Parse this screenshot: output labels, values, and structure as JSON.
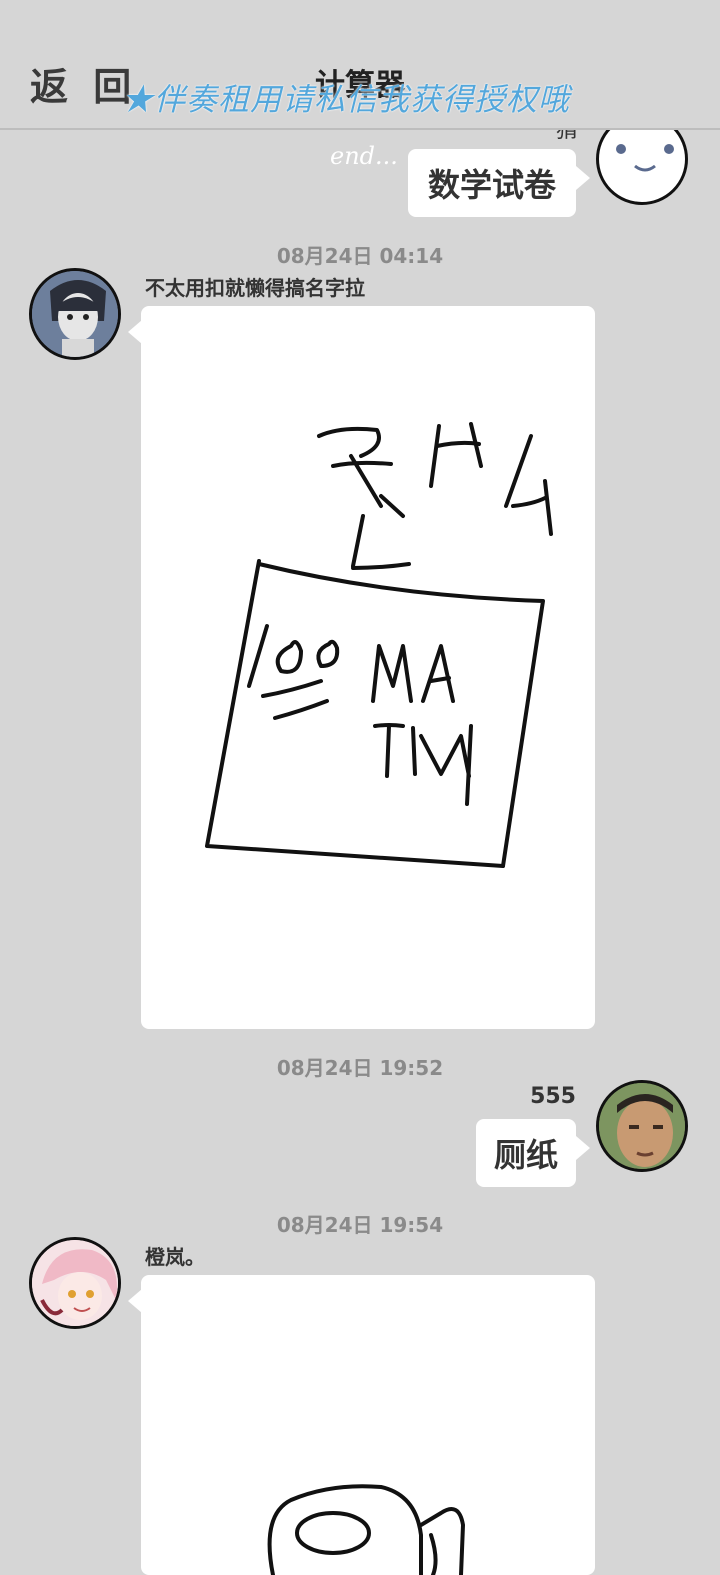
{
  "header": {
    "back_label": "返 回",
    "title": "计算器",
    "watermark": "★伴奏租用请私信我获得授权哦"
  },
  "messages": [
    {
      "id": "m1",
      "side": "right",
      "sender": "",
      "caption": "end...",
      "text": "数学试卷",
      "avatar_icon": "smiley-face-icon"
    },
    {
      "id": "m2",
      "timestamp": "08月24日  04:14",
      "side": "left",
      "sender": "不太用扣就懒得搞名字拉",
      "content_type": "drawing",
      "drawing_text": [
        "是什么",
        "100 MATH"
      ],
      "avatar_icon": "anime-boy-avatar"
    },
    {
      "id": "m3",
      "timestamp": "08月24日  19:52",
      "side": "right",
      "sender": "555",
      "text": "厕纸",
      "avatar_icon": "photo-face-avatar"
    },
    {
      "id": "m4",
      "timestamp": "08月24日  19:54",
      "side": "left",
      "sender": "橙岚。",
      "content_type": "drawing",
      "drawing_subject": "toilet-paper-roll",
      "avatar_icon": "pink-hair-avatar"
    }
  ],
  "colors": {
    "background": "#d6d6d6",
    "bubble": "#ffffff",
    "watermark": "#53a7dc"
  }
}
